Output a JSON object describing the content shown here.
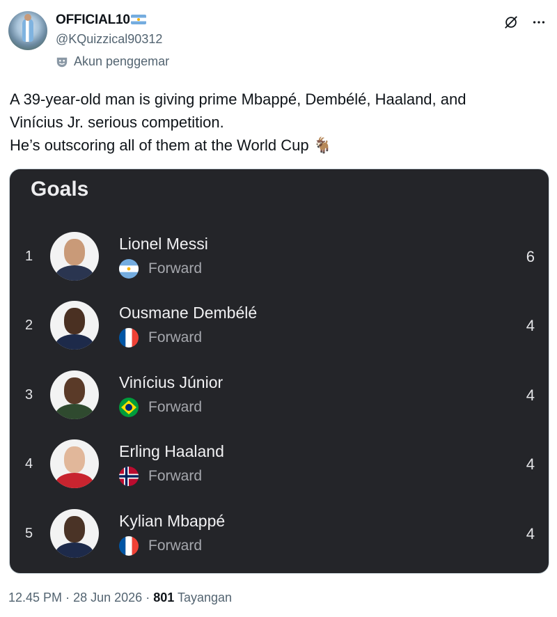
{
  "author": {
    "display_name": "OFFICIAL10",
    "handle": "@KQuizzical90312",
    "badge_label": "Akun penggemar",
    "name_flag": "argentina-flag"
  },
  "header_actions": {
    "grok_icon": "grok-icon",
    "more_icon": "more-icon"
  },
  "tweet": {
    "lines": [
      "A 39-year-old man is giving prime Mbappé, Dembélé, Haaland, and",
      "Vinícius Jr. serious competition.",
      "He’s outscoring all of them at the World Cup 🐐"
    ]
  },
  "card": {
    "title": "Goals",
    "players": [
      {
        "rank": "1",
        "name": "Lionel Messi",
        "position": "Forward",
        "goals": "6",
        "country": "argentina"
      },
      {
        "rank": "2",
        "name": "Ousmane Dembélé",
        "position": "Forward",
        "goals": "4",
        "country": "france"
      },
      {
        "rank": "3",
        "name": "Vinícius Júnior",
        "position": "Forward",
        "goals": "4",
        "country": "brazil"
      },
      {
        "rank": "4",
        "name": "Erling Haaland",
        "position": "Forward",
        "goals": "4",
        "country": "norway"
      },
      {
        "rank": "5",
        "name": "Kylian Mbappé",
        "position": "Forward",
        "goals": "4",
        "country": "france"
      }
    ]
  },
  "meta": {
    "time": "12.45 PM",
    "separator": "·",
    "date": "28 Jun 2026",
    "views_count": "801",
    "views_label": "Tayangan"
  },
  "colors": {
    "card_bg": "#242529",
    "secondary_text": "#536471",
    "primary_text": "#0f1419"
  }
}
